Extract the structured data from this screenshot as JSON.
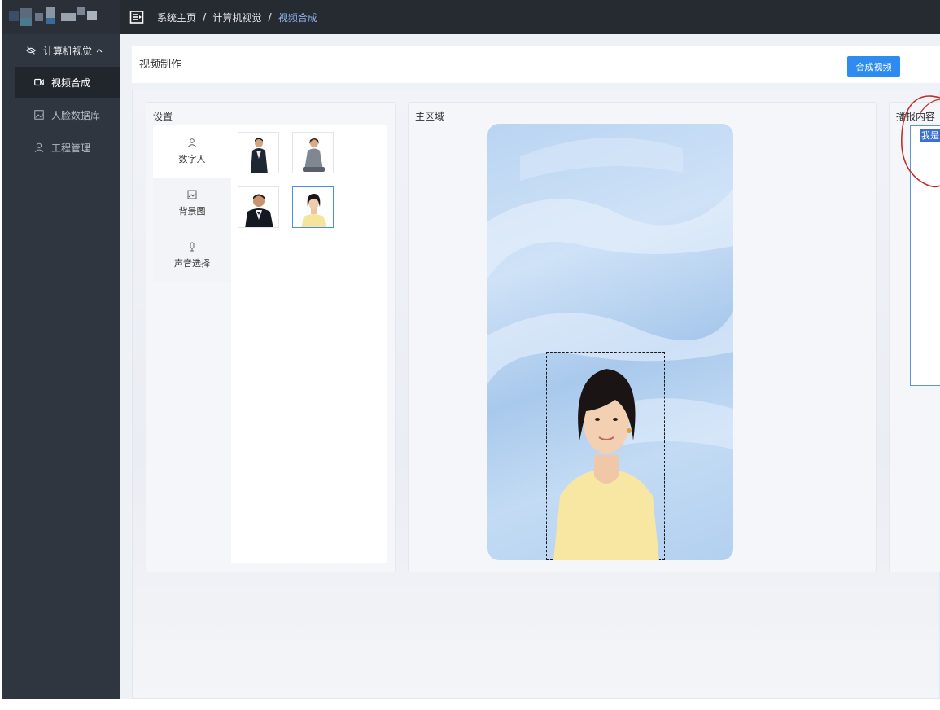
{
  "header": {
    "breadcrumbs": [
      "系统主页",
      "计算机视觉",
      "视频合成"
    ]
  },
  "sidebar": {
    "group_label": "计算机视觉",
    "items": [
      {
        "label": "视频合成",
        "active": true
      },
      {
        "label": "人脸数据库",
        "active": false
      },
      {
        "label": "工程管理",
        "active": false
      }
    ]
  },
  "topbar": {
    "title": "视频制作",
    "compose_button": "合成视频"
  },
  "settings": {
    "title": "设置",
    "tabs": [
      {
        "label": "数字人",
        "icon": "user-icon"
      },
      {
        "label": "背景图",
        "icon": "image-icon"
      },
      {
        "label": "声音选择",
        "icon": "microphone-icon"
      }
    ],
    "thumbnails": [
      "man-in-suit",
      "woman-seated",
      "man-in-tuxedo",
      "woman-yellow-sweater"
    ],
    "selected_thumbnail": 3
  },
  "main_area": {
    "title": "主区域"
  },
  "broadcast": {
    "title": "播报内容",
    "text_visible": "我是i"
  },
  "colors": {
    "primary": "#2e8cf0",
    "sidebar_bg": "#30363f",
    "header_bg": "#262a31",
    "breadcrumb_current": "#8fb3ea",
    "annotation": "#c0302b"
  }
}
